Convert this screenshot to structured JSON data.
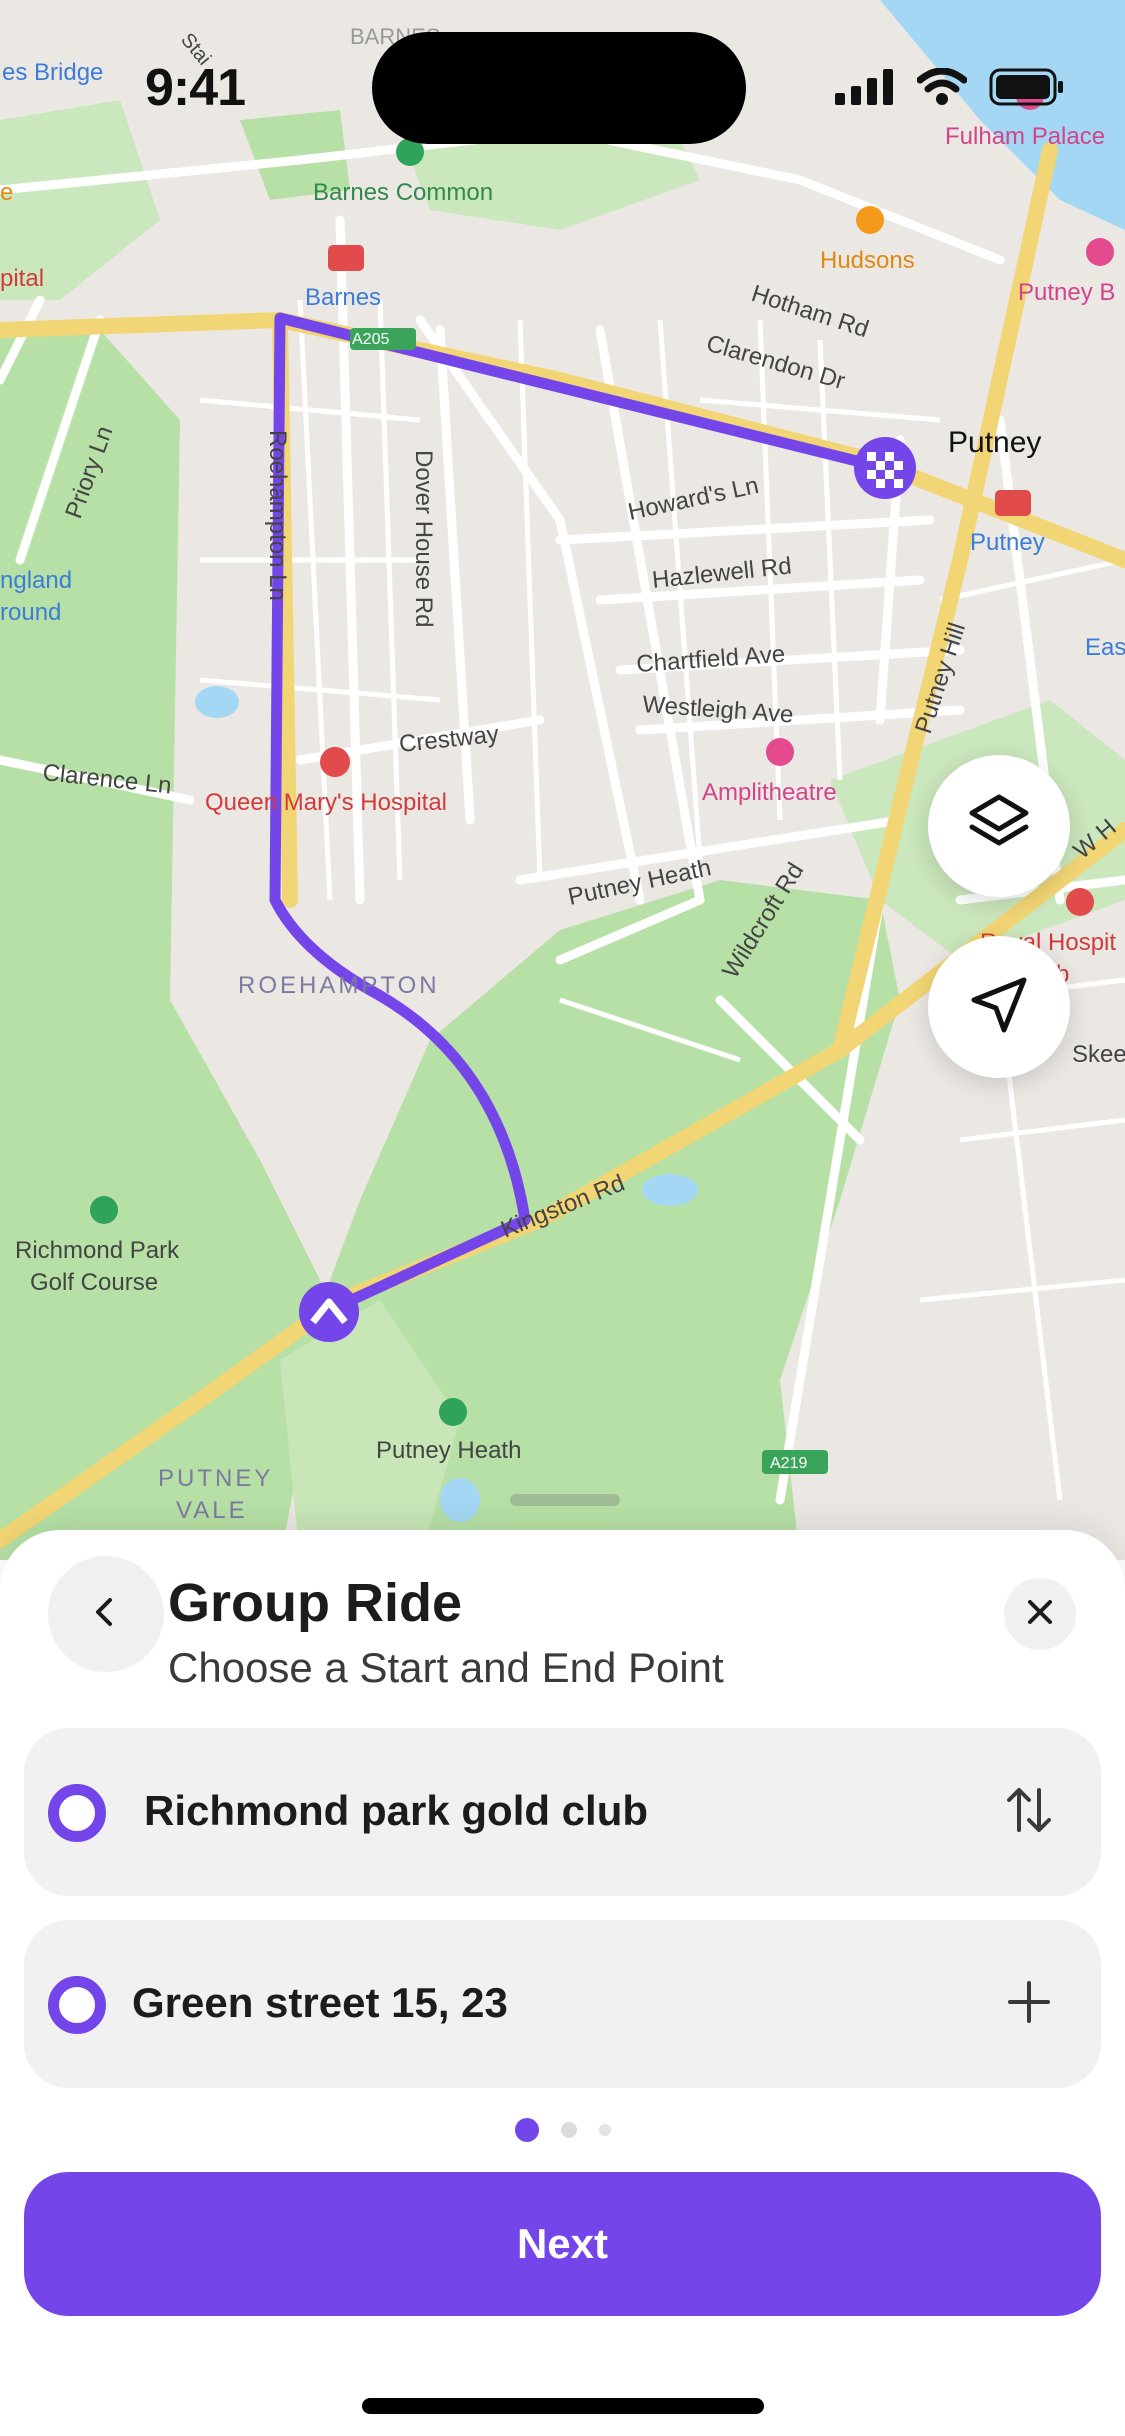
{
  "status_bar": {
    "time": "9:41"
  },
  "map": {
    "labels": {
      "barnes_bridge": "es Bridge",
      "staircase": "Stai",
      "barnes_top": "BARNES",
      "fulham_palace": "Fulham Palace",
      "barnes_common": "Barnes Common",
      "barnes": "Barnes",
      "hudsons": "Hudsons",
      "putney_b": "Putney B",
      "hotham": "Hotham Rd",
      "clarendon": "Clarendon Dr",
      "putney": "Putney",
      "putney_station": "Putney",
      "pital": "pital",
      "a205": "A205",
      "priory": "Priory Ln",
      "roehampton_ln": "Roehampton Ln",
      "dover_house": "Dover House Rd",
      "howards": "Howard's Ln",
      "hazlewell": "Hazlewell Rd",
      "putney_hill": "Putney Hill",
      "east": "East",
      "england": "ngland",
      "round": "round",
      "chartfield": "Chartfield Ave",
      "westleigh": "Westleigh Ave",
      "crestway": "Crestway",
      "clarence": "Clarence Ln",
      "queen_mary": "Queen Mary's Hospital",
      "amplitheatre": "Amplitheatre",
      "putney_heath_rd": "Putney Heath",
      "wildcroft": "Wildcroft Rd",
      "w_h": "W H",
      "royal_hosp": "Royal Hospit",
      "disab": "-Disab",
      "roehampton": "ROEHAMPTON",
      "skee": "Skee",
      "kingston": "Kingston Rd",
      "richmond_park": "Richmond Park",
      "golf_course": "Golf Course",
      "putney_heath": "Putney Heath",
      "a219": "A219",
      "putney_vale_1": "PUTNEY",
      "putney_vale_2": "VALE",
      "e_label": "e"
    }
  },
  "controls": {
    "layers_icon": "layers-icon",
    "locate_icon": "navigation-arrow-icon"
  },
  "sheet": {
    "title": "Group Ride",
    "subtitle": "Choose a Start and End Point",
    "start_point": "Richmond park gold club",
    "end_point": "Green street 15, 23",
    "next_label": "Next",
    "pagination": {
      "total": 3,
      "current": 1
    }
  },
  "colors": {
    "accent": "#7446ea",
    "route": "#7446ea",
    "park": "#a9dd99",
    "water": "#9fd6f2",
    "road_major": "#f3d672"
  }
}
